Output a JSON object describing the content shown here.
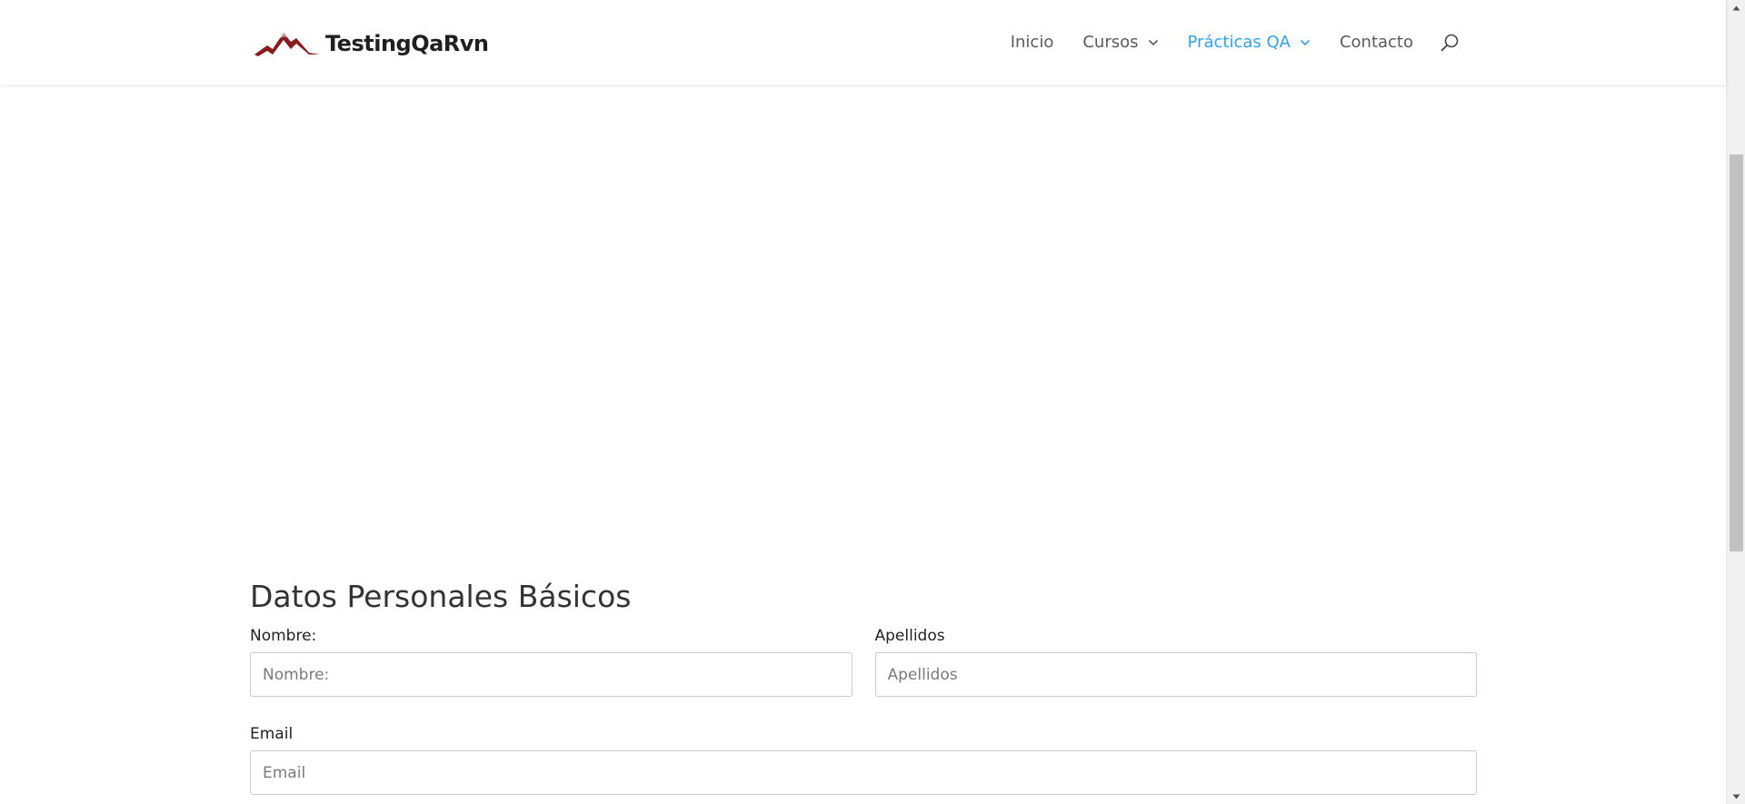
{
  "header": {
    "logo_text": "TestingQaRvn",
    "nav": [
      {
        "label": "Inicio",
        "has_dropdown": false,
        "active": false
      },
      {
        "label": "Cursos",
        "has_dropdown": true,
        "active": false
      },
      {
        "label": "Prácticas QA",
        "has_dropdown": true,
        "active": true
      },
      {
        "label": "Contacto",
        "has_dropdown": false,
        "active": false
      }
    ],
    "search_icon": "search-icon"
  },
  "form": {
    "title": "Datos Personales Básicos",
    "nombre": {
      "label": "Nombre:",
      "placeholder": "Nombre:",
      "value": ""
    },
    "apellidos": {
      "label": "Apellidos",
      "placeholder": "Apellidos",
      "value": ""
    },
    "email": {
      "label": "Email",
      "placeholder": "Email",
      "value": ""
    }
  },
  "colors": {
    "accent": "#2ea3f2",
    "nav_text": "#5a5a5a",
    "logo_mountain": "#8b1a1a",
    "input_border": "#c9c9c9"
  }
}
